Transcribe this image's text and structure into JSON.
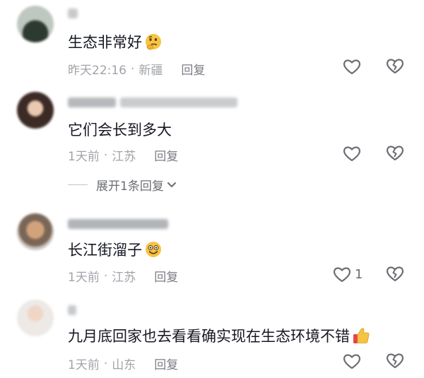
{
  "comments": [
    {
      "text": "生态非常好",
      "emoji": "thinking-face-emoji",
      "time": "昨天22:16",
      "location": "新疆",
      "reply_label": "回复",
      "likes": ""
    },
    {
      "text": "它们会长到多大",
      "emoji": "",
      "time": "1天前",
      "location": "江苏",
      "reply_label": "回复",
      "likes": ""
    },
    {
      "text": "长江街溜子",
      "emoji": "smiling-face-emoji",
      "time": "1天前",
      "location": "江苏",
      "reply_label": "回复",
      "likes": "1"
    },
    {
      "text": "九月底回家也去看看确实现在生态环境不错",
      "emoji": "thumbs-up-emoji",
      "time": "1天前",
      "location": "山东",
      "reply_label": "回复",
      "likes": ""
    }
  ],
  "expand_replies": {
    "label": "展开1条回复"
  },
  "separator": "·",
  "colors": {
    "text": "#161823",
    "meta": "#a1a3a8",
    "icon": "#6b6d73"
  }
}
